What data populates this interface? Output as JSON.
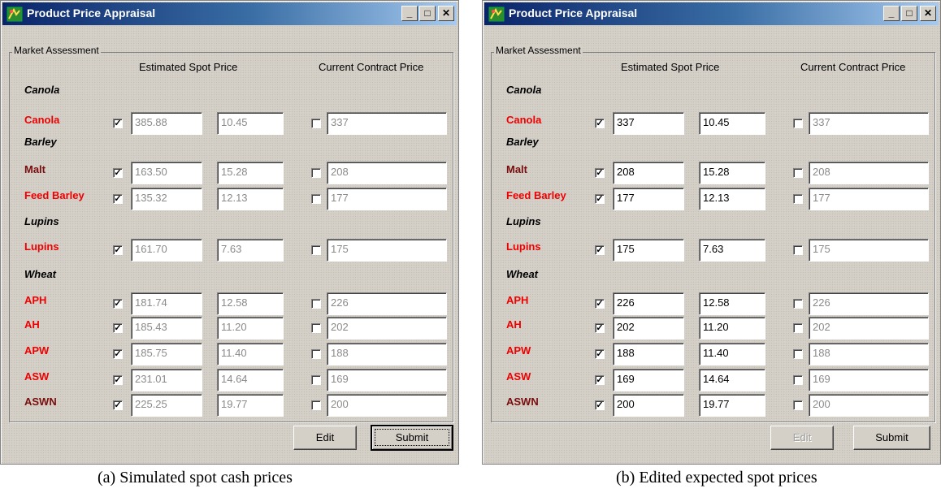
{
  "captions": [
    "(a) Simulated spot cash prices",
    "(b) Edited expected spot prices"
  ],
  "windows": [
    {
      "title": "Product Price Appraisal",
      "group_label": "Market Assessment",
      "col_spot": "Estimated Spot Price",
      "col_contract": "Current Contract Price",
      "sections": [
        "Canola",
        "Barley",
        "Lupins",
        "Wheat"
      ],
      "rows": [
        {
          "label": "Canola",
          "color": "#ee0000",
          "spot_checked": "✓",
          "spot": "385.88",
          "spot2": "10.45",
          "contract_checked": "",
          "contract": "337"
        },
        {
          "label": "Malt",
          "color": "#7a0c0c",
          "spot_checked": "✓",
          "spot": "163.50",
          "spot2": "15.28",
          "contract_checked": "",
          "contract": "208"
        },
        {
          "label": "Feed Barley",
          "color": "#ee0000",
          "spot_checked": "✓",
          "spot": "135.32",
          "spot2": "12.13",
          "contract_checked": "",
          "contract": "177"
        },
        {
          "label": "Lupins",
          "color": "#ee0000",
          "spot_checked": "✓",
          "spot": "161.70",
          "spot2": "7.63",
          "contract_checked": "",
          "contract": "175"
        },
        {
          "label": "APH",
          "color": "#ee0000",
          "spot_checked": "✓",
          "spot": "181.74",
          "spot2": "12.58",
          "contract_checked": "",
          "contract": "226"
        },
        {
          "label": "AH",
          "color": "#ee0000",
          "spot_checked": "✓",
          "spot": "185.43",
          "spot2": "11.20",
          "contract_checked": "",
          "contract": "202"
        },
        {
          "label": "APW",
          "color": "#ee0000",
          "spot_checked": "✓",
          "spot": "185.75",
          "spot2": "11.40",
          "contract_checked": "",
          "contract": "188"
        },
        {
          "label": "ASW",
          "color": "#ee0000",
          "spot_checked": "✓",
          "spot": "231.01",
          "spot2": "14.64",
          "contract_checked": "",
          "contract": "169"
        },
        {
          "label": "ASWN",
          "color": "#7a0c0c",
          "spot_checked": "✓",
          "spot": "225.25",
          "spot2": "19.77",
          "contract_checked": "",
          "contract": "200"
        }
      ],
      "edit_label": "Edit",
      "submit_label": "Submit",
      "edit_enabled": true,
      "fields_editable": false
    },
    {
      "title": "Product Price Appraisal",
      "group_label": "Market Assessment",
      "col_spot": "Estimated Spot Price",
      "col_contract": "Current Contract Price",
      "sections": [
        "Canola",
        "Barley",
        "Lupins",
        "Wheat"
      ],
      "rows": [
        {
          "label": "Canola",
          "color": "#ee0000",
          "spot_checked": "✓",
          "spot": "337",
          "spot2": "10.45",
          "contract_checked": "",
          "contract": "337"
        },
        {
          "label": "Malt",
          "color": "#7a0c0c",
          "spot_checked": "✓",
          "spot": "208",
          "spot2": "15.28",
          "contract_checked": "",
          "contract": "208"
        },
        {
          "label": "Feed Barley",
          "color": "#ee0000",
          "spot_checked": "✓",
          "spot": "177",
          "spot2": "12.13",
          "contract_checked": "",
          "contract": "177"
        },
        {
          "label": "Lupins",
          "color": "#ee0000",
          "spot_checked": "✓",
          "spot": "175",
          "spot2": "7.63",
          "contract_checked": "",
          "contract": "175"
        },
        {
          "label": "APH",
          "color": "#ee0000",
          "spot_checked": "✓",
          "spot": "226",
          "spot2": "12.58",
          "contract_checked": "",
          "contract": "226"
        },
        {
          "label": "AH",
          "color": "#ee0000",
          "spot_checked": "✓",
          "spot": "202",
          "spot2": "11.20",
          "contract_checked": "",
          "contract": "202"
        },
        {
          "label": "APW",
          "color": "#ee0000",
          "spot_checked": "✓",
          "spot": "188",
          "spot2": "11.40",
          "contract_checked": "",
          "contract": "188"
        },
        {
          "label": "ASW",
          "color": "#ee0000",
          "spot_checked": "✓",
          "spot": "169",
          "spot2": "14.64",
          "contract_checked": "",
          "contract": "169"
        },
        {
          "label": "ASWN",
          "color": "#7a0c0c",
          "spot_checked": "✓",
          "spot": "200",
          "spot2": "19.77",
          "contract_checked": "",
          "contract": "200"
        }
      ],
      "edit_label": "Edit",
      "submit_label": "Submit",
      "edit_enabled": false,
      "fields_editable": true
    }
  ]
}
